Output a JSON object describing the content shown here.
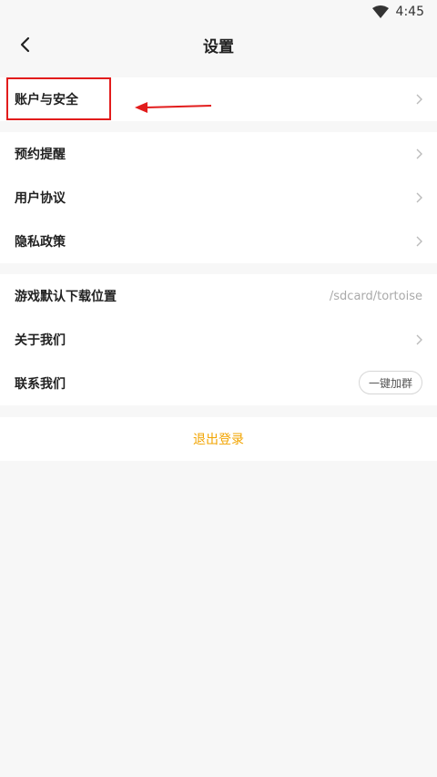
{
  "status_bar": {
    "time": "4:45",
    "wifi_icon": "wifi-icon"
  },
  "header": {
    "title": "设置",
    "back_icon": "chevron-left-icon"
  },
  "groups": {
    "account": [
      {
        "label": "账户与安全",
        "trailing": "chevron-right-icon"
      }
    ],
    "info": [
      {
        "label": "预约提醒",
        "trailing": "chevron-right-icon"
      },
      {
        "label": "用户协议",
        "trailing": "chevron-right-icon"
      },
      {
        "label": "隐私政策",
        "trailing": "chevron-right-icon"
      }
    ],
    "misc": [
      {
        "label": "游戏默认下载位置",
        "value": "/sdcard/tortoise"
      },
      {
        "label": "关于我们",
        "trailing": "chevron-right-icon"
      },
      {
        "label": "联系我们",
        "button": "一键加群"
      }
    ]
  },
  "logout": {
    "label": "退出登录"
  },
  "colors": {
    "accent": "#f2a400",
    "annotation": "#e21c1c",
    "background": "#f7f7f7"
  }
}
